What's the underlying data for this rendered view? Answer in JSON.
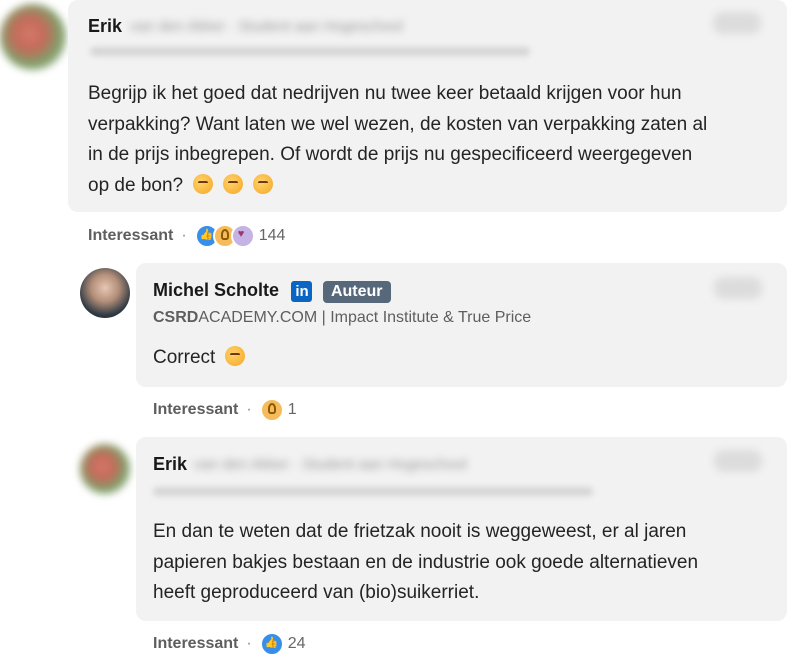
{
  "comments": [
    {
      "author": "Erik",
      "author_rest_blurred": "van den Akker · Student aan Hogeschool",
      "headline_blurred": "IT · adviseur | consultancy | CRM Salesforce specialist",
      "text": "Begrijp ik het goed dat nedrijven nu twee keer betaald krijgen voor hun verpakking? Want laten we wel wezen, de kosten van verpakking zaten al in de prijs inbegrepen. Of wordt de prijs nu gespecificeerd weergegeven op de bon?",
      "text_lines": [
        "Begrijp ik het goed dat nedrijven nu twee keer betaald krijgen voor hun",
        "verpakking? Want laten we wel wezen, de kosten van verpakking zaten al",
        "in de prijs inbegrepen. Of wordt de prijs nu gespecificeerd weergegeven",
        "op de bon?"
      ],
      "emojis": [
        "thinking-face-emoji",
        "thinking-face-emoji",
        "thinking-face-emoji"
      ],
      "reaction_label": "Interessant",
      "reaction_icons": [
        "like-reaction-icon",
        "insightful-reaction-icon",
        "love-reaction-icon"
      ],
      "reaction_count": "144"
    },
    {
      "author": "Michel Scholte",
      "badge": "Auteur",
      "headline_bold": "CSRD",
      "headline_rest": "ACADEMY.COM | Impact Institute & True Price",
      "text": "Correct",
      "emojis": [
        "drooling-face-emoji"
      ],
      "reaction_label": "Interessant",
      "reaction_icons": [
        "insightful-reaction-icon"
      ],
      "reaction_count": "1"
    },
    {
      "author": "Erik",
      "author_rest_blurred": "van den Akker · Student aan Hogeschool",
      "headline_blurred": "IT · adviseur | consultancy | CRM Salesforce specialist",
      "text_lines": [
        "En dan te weten dat de frietzak nooit is weggeweest, er al jaren",
        "papieren bakjes bestaan en de industrie ook goede alternatieven",
        "heeft geproduceerd van (bio)suikerriet."
      ],
      "reaction_label": "Interessant",
      "reaction_icons": [
        "like-reaction-icon"
      ],
      "reaction_count": "24"
    }
  ],
  "linkedin_logo_text": "in",
  "colors": {
    "bubble": "#f2f2f2",
    "linkedin_blue": "#0a66c2",
    "badge": "#56687a"
  }
}
